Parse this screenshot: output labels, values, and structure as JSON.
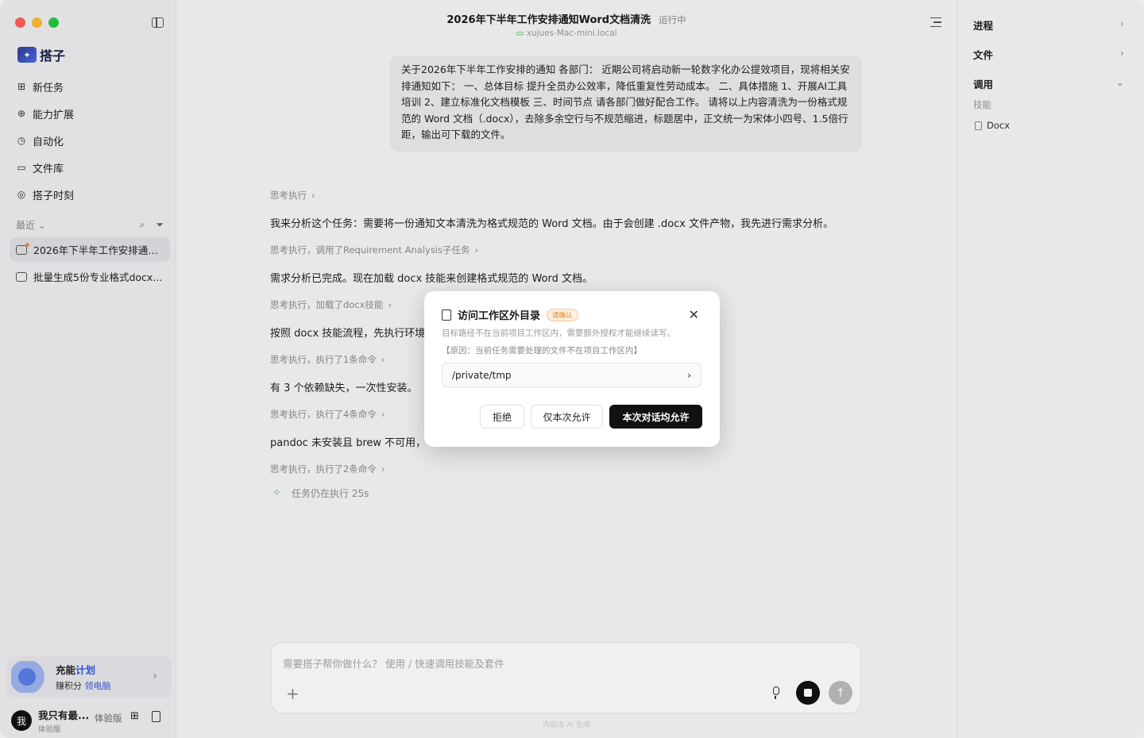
{
  "sidebar": {
    "logo_text": "搭子",
    "nav": [
      {
        "label": "新任务",
        "icon": "new-task-icon"
      },
      {
        "label": "能力扩展",
        "icon": "extensions-icon"
      },
      {
        "label": "自动化",
        "icon": "clock-icon"
      },
      {
        "label": "文件库",
        "icon": "folder-icon"
      },
      {
        "label": "搭子时刻",
        "icon": "moments-icon"
      }
    ],
    "recent_label": "最近",
    "recent": [
      {
        "label": "2026年下半年工作安排通知..."
      },
      {
        "label": "批量生成5份专业格式docx..."
      }
    ],
    "promo": {
      "title_a": "充能",
      "title_b": "计划",
      "sub_a": "赚积分",
      "sub_b": "领电脑"
    },
    "user": {
      "avatar": "我",
      "name": "我只有最...",
      "tier": "体验版",
      "plan": "体验版"
    }
  },
  "header": {
    "title": "2026年下半年工作安排通知Word文档清洗",
    "status": "运行中",
    "host": "xujues-Mac-mini.local"
  },
  "conversation": {
    "user_message": "关于2026年下半年工作安排的通知 各部门： 近期公司将启动新一轮数字化办公提效项目，现将相关安排通知如下： 一、总体目标 提升全员办公效率，降低重复性劳动成本。 二、具体措施 1、开展AI工具培训 2、建立标准化文档模板 三、时间节点 请各部门做好配合工作。 请将以上内容清洗为一份格式规范的 Word 文档（.docx），去除多余空行与不规范缩进，标题居中，正文统一为宋体小四号、1.5倍行距，输出可下载的文件。",
    "steps": [
      {
        "think": "思考执行",
        "msg": "我来分析这个任务：需要将一份通知文本清洗为格式规范的 Word 文档。由于会创建 .docx 文件产物，我先进行需求分析。"
      },
      {
        "think": "思考执行，调用了Requirement Analysis子任务",
        "msg": "需求分析已完成。现在加载 docx 技能来创建格式规范的 Word 文档。"
      },
      {
        "think": "思考执行，加载了docx技能",
        "msg": "按照 docx 技能流程，先执行环境"
      },
      {
        "think": "思考执行，执行了1条命令",
        "msg": "有 3 个依赖缺失，一次性安装。"
      },
      {
        "think": "思考执行，执行了4条命令",
        "msg": "pandoc 未安装且 brew 不可用，"
      },
      {
        "think": "思考执行，执行了2条命令",
        "msg": ""
      }
    ],
    "running": "任务仍在执行 25s"
  },
  "composer": {
    "placeholder": "需要搭子帮你做什么？ 使用 / 快速调用技能及套件",
    "footnote": "内容由 AI 生成"
  },
  "right_panel": {
    "progress": "进程",
    "files": "文件",
    "calls": "调用",
    "skills_label": "技能",
    "skill_item": "Docx"
  },
  "modal": {
    "title": "访问工作区外目录",
    "badge": "请确认",
    "desc": "目标路径不在当前项目工作区内，需要额外授权才能继续读写。",
    "reason": "【原因：当前任务需要处理的文件不在项目工作区内】",
    "path": "/private/tmp",
    "reject": "拒绝",
    "allow_once": "仅本次允许",
    "allow_session": "本次对话均允许"
  }
}
